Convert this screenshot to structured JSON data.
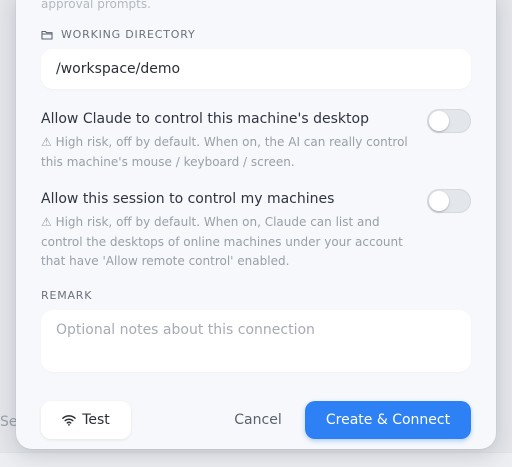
{
  "background": {
    "partial_text": "Se"
  },
  "dialog": {
    "faded_text": "approval prompts.",
    "working_directory": {
      "label": "WORKING DIRECTORY",
      "icon": "folder-icon",
      "value": "/workspace/demo"
    },
    "toggles": [
      {
        "title": "Allow Claude to control this machine's desktop",
        "description": "⚠ High risk, off by default. When on, the AI can really control this machine's mouse / keyboard / screen.",
        "enabled": false
      },
      {
        "title": "Allow this session to control my machines",
        "description": "⚠ High risk, off by default. When on, Claude can list and control the desktops of online machines under your account that have 'Allow remote control' enabled.",
        "enabled": false
      }
    ],
    "remark": {
      "label": "REMARK",
      "placeholder": "Optional notes about this connection",
      "value": ""
    },
    "footer": {
      "test_label": "Test",
      "test_icon": "wifi-icon",
      "cancel_label": "Cancel",
      "create_label": "Create & Connect"
    }
  },
  "colors": {
    "primary": "#2e80f5",
    "dialog_bg": "#f6f8fb",
    "field_bg": "#ffffff",
    "muted_text": "#9aa0a8"
  }
}
